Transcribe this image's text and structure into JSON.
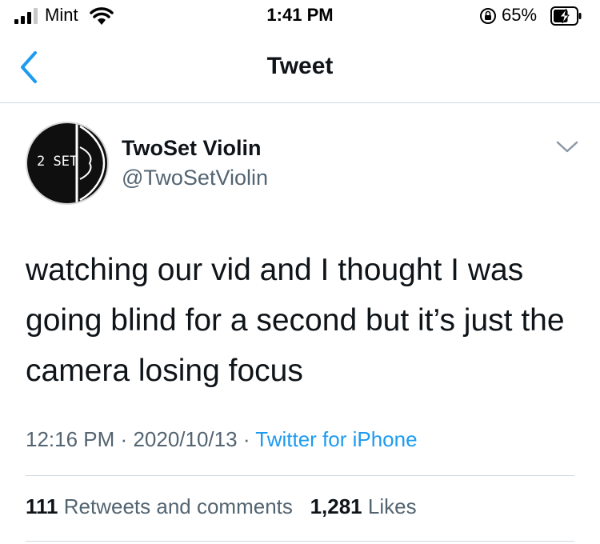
{
  "status_bar": {
    "carrier": "Mint",
    "time": "1:41 PM",
    "battery_percent": "65%",
    "signal_bars": 3,
    "battery_level": 0.65,
    "icons": [
      "signal-icon",
      "wifi-icon",
      "rotation-lock-icon",
      "battery-charging-icon"
    ]
  },
  "nav": {
    "title": "Tweet",
    "back_icon": "chevron-left-icon"
  },
  "tweet": {
    "avatar_text": "2 SET",
    "display_name": "TwoSet Violin",
    "handle": "@TwoSetViolin",
    "text": "watching our vid and I thought I was going blind for a second but it’s just the camera losing focus",
    "time": "12:16 PM",
    "separator": "·",
    "date": "2020/10/13",
    "source": "Twitter for iPhone",
    "retweets_count": "111",
    "retweets_label": "Retweets and comments",
    "likes_count": "1,281",
    "likes_label": "Likes"
  },
  "colors": {
    "accent": "#1d9bf0",
    "text": "#0f1419",
    "secondary": "#536471",
    "divider": "#cfd9de"
  }
}
